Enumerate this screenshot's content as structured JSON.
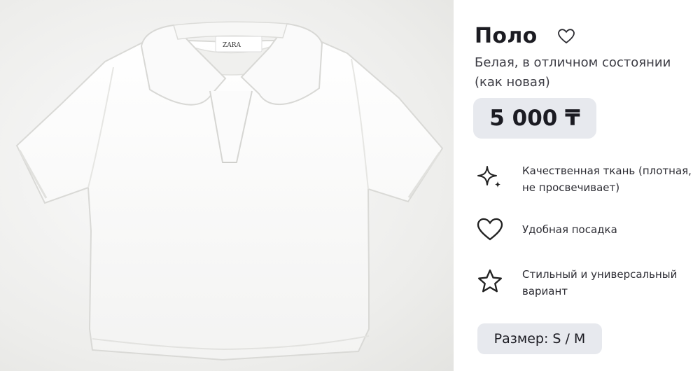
{
  "product": {
    "title": "Поло",
    "subtitle": "Белая, в отличном состоянии (как новая)",
    "price": "5 000 ₸",
    "size": "Размер: S / M",
    "label_brand": "ZARA"
  },
  "features": [
    {
      "icon": "sparkle-icon",
      "text": "Качественная ткань (плотная, не просвечивает)"
    },
    {
      "icon": "heart-icon",
      "text": "Удобная посадка"
    },
    {
      "icon": "star-icon",
      "text": "Стильный и универсальный вариант"
    }
  ],
  "colors": {
    "price_bg": "#e7e9ee",
    "text": "#1c1c22",
    "photo_bg": "#ededeb"
  }
}
